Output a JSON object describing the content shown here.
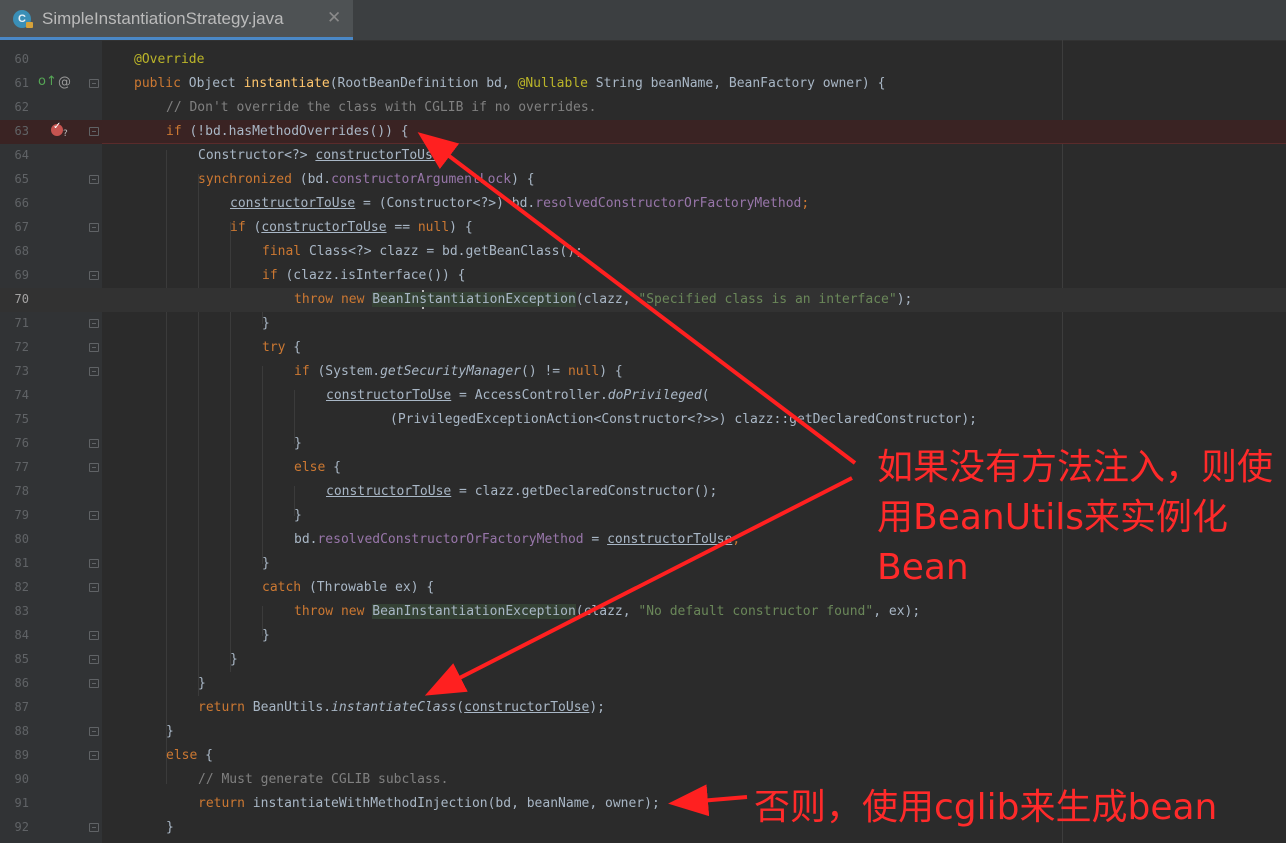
{
  "tab": {
    "title": "SimpleInstantiationStrategy.java",
    "icon_letter": "C",
    "close": "✕"
  },
  "gutter": {
    "override_icon": "override-up-arrow-icon",
    "at_icon": "@",
    "breakpoint_icon": "conditional-breakpoint-icon",
    "breakpoint_suffix": "?"
  },
  "code_lines": [
    {
      "num": "60"
    },
    {
      "num": "61"
    },
    {
      "num": "62"
    },
    {
      "num": "63"
    },
    {
      "num": "64"
    },
    {
      "num": "65"
    },
    {
      "num": "66"
    },
    {
      "num": "67"
    },
    {
      "num": "68"
    },
    {
      "num": "69"
    },
    {
      "num": "70"
    },
    {
      "num": "71"
    },
    {
      "num": "72"
    },
    {
      "num": "73"
    },
    {
      "num": "74"
    },
    {
      "num": "75"
    },
    {
      "num": "76"
    },
    {
      "num": "77"
    },
    {
      "num": "78"
    },
    {
      "num": "79"
    },
    {
      "num": "80"
    },
    {
      "num": "81"
    },
    {
      "num": "82"
    },
    {
      "num": "83"
    },
    {
      "num": "84"
    },
    {
      "num": "85"
    },
    {
      "num": "86"
    },
    {
      "num": "87"
    },
    {
      "num": "88"
    },
    {
      "num": "89"
    },
    {
      "num": "90"
    },
    {
      "num": "91"
    },
    {
      "num": "92"
    }
  ],
  "tokens": {
    "l60": [
      "@Override"
    ],
    "l61": [
      "public",
      " Object ",
      "instantiate",
      "(RootBeanDefinition bd, ",
      "@Nullable",
      " String beanName, BeanFactory owner) {"
    ],
    "l62": [
      "// Don't override the class with CGLIB if no overrides."
    ],
    "l63": [
      "if",
      " (!bd.hasMethodOverrides()) {"
    ],
    "l64": [
      "Constructor<?> ",
      "constructorToUse",
      ";"
    ],
    "l65": [
      "synchronized",
      " (bd.",
      "constructorArgumentLock",
      ") {"
    ],
    "l66": [
      "constructorToUse",
      " = (Constructor<?>) bd.",
      "resolvedConstructorOrFactoryMethod",
      ";"
    ],
    "l67": [
      "if",
      " (",
      "constructorToUse",
      " == ",
      "null",
      ") {"
    ],
    "l68": [
      "final",
      " Class<?> clazz = bd.getBeanClass();"
    ],
    "l69": [
      "if",
      " (clazz.isInterface()) {"
    ],
    "l70": [
      "throw new",
      " ",
      "BeanInstantiationException",
      "(clazz, ",
      "\"Specified class is an interface\"",
      ");"
    ],
    "l71": [
      "}"
    ],
    "l72": [
      "try",
      " {"
    ],
    "l73": [
      "if",
      " (System.",
      "getSecurityManager",
      "() != ",
      "null",
      ") {"
    ],
    "l74": [
      "constructorToUse",
      " = AccessController.",
      "doPrivileged",
      "("
    ],
    "l75": [
      "(PrivilegedExceptionAction<Constructor<?>>) clazz::getDeclaredConstructor);"
    ],
    "l76": [
      "}"
    ],
    "l77": [
      "else",
      " {"
    ],
    "l78": [
      "constructorToUse",
      " = clazz.getDeclaredConstructor();"
    ],
    "l79": [
      "}"
    ],
    "l80": [
      "bd.",
      "resolvedConstructorOrFactoryMethod",
      " = ",
      "constructorToUse",
      ";"
    ],
    "l81": [
      "}"
    ],
    "l82": [
      "catch",
      " (Throwable ex) {"
    ],
    "l83": [
      "throw new",
      " ",
      "BeanInstantiationException",
      "(clazz, ",
      "\"No default constructor found\"",
      ", ex);"
    ],
    "l84": [
      "}"
    ],
    "l85": [
      "}"
    ],
    "l86": [
      "}"
    ],
    "l87": [
      "return",
      " BeanUtils.",
      "instantiateClass",
      "(",
      "constructorToUse",
      ");"
    ],
    "l88": [
      "}"
    ],
    "l89": [
      "else",
      " {"
    ],
    "l90": [
      "// Must generate CGLIB subclass."
    ],
    "l91": [
      "return",
      " instantiateWithMethodInjection(bd, beanName, owner);"
    ],
    "l92": [
      "}"
    ]
  },
  "annotations": {
    "note1_line1": "如果没有方法注入，则使",
    "note1_line2": "用BeanUtils来实例化",
    "note1_line3": "Bean",
    "note2": "否则，使用cglib来生成bean",
    "arrow_color": "#ff2020"
  },
  "colors": {
    "background": "#2b2b2b",
    "gutter": "#313335",
    "keyword": "#cc7832",
    "annotation_text": "#ff2a2a"
  }
}
